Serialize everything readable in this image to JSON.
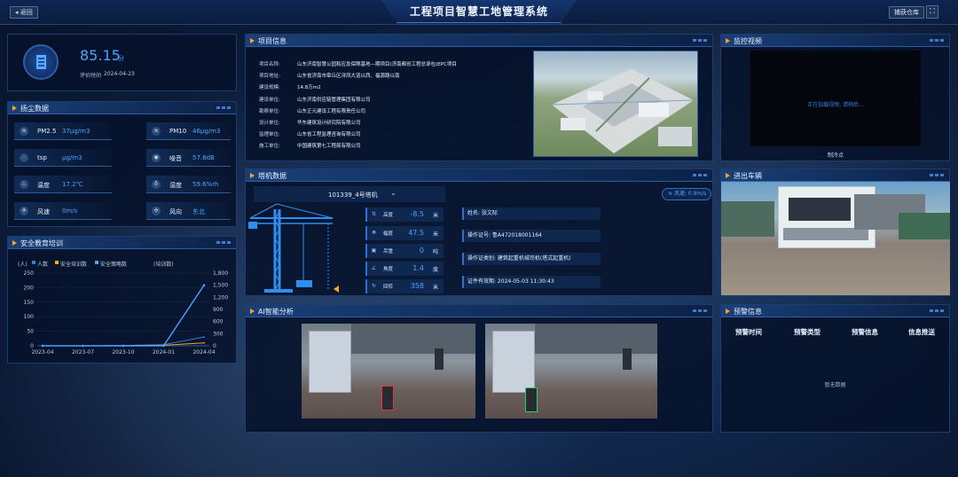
{
  "header": {
    "title": "工程项目智慧工地管理系统",
    "back_label": "返回",
    "right_label": "捕获仓库"
  },
  "score": {
    "value": "85.15",
    "unit": "分",
    "date_label": "评价时间",
    "date": "2024-04-23"
  },
  "dust": {
    "title": "扬尘数据",
    "items": [
      {
        "name": "PM2.5",
        "value": "37μg/m3"
      },
      {
        "name": "PM10",
        "value": "46μg/m3"
      },
      {
        "name": "tsp",
        "value": "μg/m3"
      },
      {
        "name": "噪音",
        "value": "57.8dB"
      },
      {
        "name": "温度",
        "value": "17.2℃"
      },
      {
        "name": "湿度",
        "value": "59.6%rh"
      },
      {
        "name": "风速",
        "value": "0m/s"
      },
      {
        "name": "风向",
        "value": "东北"
      }
    ]
  },
  "training": {
    "title": "安全教育培训",
    "unit_left": "(人)",
    "unit_right": "(培训数)",
    "legend": [
      "人数",
      "安全培训数",
      "安全策略数"
    ]
  },
  "chart_data": {
    "type": "line",
    "x": [
      "2023-04",
      "2023-07",
      "2023-10",
      "2024-01",
      "2024-04"
    ],
    "y_left_ticks": [
      "250",
      "200",
      "150",
      "100",
      "50",
      "0"
    ],
    "y_right_ticks": [
      "1,800",
      "1,500",
      "1,200",
      "900",
      "600",
      "300",
      "0"
    ],
    "ylim_left": [
      0,
      250
    ],
    "ylim_right": [
      0,
      1800
    ],
    "series": [
      {
        "name": "人数",
        "values": [
          0,
          0,
          1,
          4,
          30
        ]
      },
      {
        "name": "安全培训数",
        "values": [
          0,
          0,
          0,
          2,
          10
        ]
      },
      {
        "name": "安全策略数",
        "values": [
          0,
          0,
          0,
          1,
          1500
        ]
      }
    ],
    "colors": [
      "#2f7ce8",
      "#f5a623",
      "#4aa3ff"
    ]
  },
  "project": {
    "title": "项目信息",
    "rows": [
      {
        "k": "项目名称:",
        "v": "山东济南智慧公园和应急保障基地—期项目(济南都创工程总承包)EPC项目"
      },
      {
        "k": "项目地址:",
        "v": "山东省济南市章丘区浔凤大道以西、福源路以南"
      },
      {
        "k": "建设规模:",
        "v": "14.8万m2"
      },
      {
        "k": "建设单位:",
        "v": "山东济南供应链管理集团有限公司"
      },
      {
        "k": "勘察单位:",
        "v": "山东正元建设工程有限责任公司"
      },
      {
        "k": "设计单位:",
        "v": "华东建筑设计研究院有限公司"
      },
      {
        "k": "监理单位:",
        "v": "山东省工程监理咨询有限公司"
      },
      {
        "k": "施工单位:",
        "v": "中国建筑第七工程局有限公司"
      }
    ]
  },
  "crane": {
    "title": "塔机数据",
    "device": "101339_4号塔机",
    "wind": "风速: 0.9m/s",
    "metrics": [
      {
        "name": "高度",
        "value": "-8.5",
        "unit": "米"
      },
      {
        "name": "幅度",
        "value": "47.5",
        "unit": "米"
      },
      {
        "name": "吊重",
        "value": "0",
        "unit": "吨"
      },
      {
        "name": "角度",
        "value": "1.4",
        "unit": "度"
      },
      {
        "name": "回转",
        "value": "358",
        "unit": "米"
      }
    ],
    "info": [
      "姓名: 张文际",
      "操作证号: 鲁A472018001164",
      "操作证类别: 建筑起重机械司机(塔式起重机)",
      "证件有效期: 2024-05-03 11:30:43"
    ]
  },
  "monitor": {
    "title": "监控视频",
    "loading": "正在加载视频, 请稍后...",
    "camera": "制冷点"
  },
  "vehicle": {
    "title": "进出车辆"
  },
  "ai": {
    "title": "AI智能分析"
  },
  "warning": {
    "title": "预警信息",
    "headers": [
      "预警时间",
      "预警类型",
      "预警信息",
      "信息推送"
    ],
    "empty": "暂无数据"
  }
}
